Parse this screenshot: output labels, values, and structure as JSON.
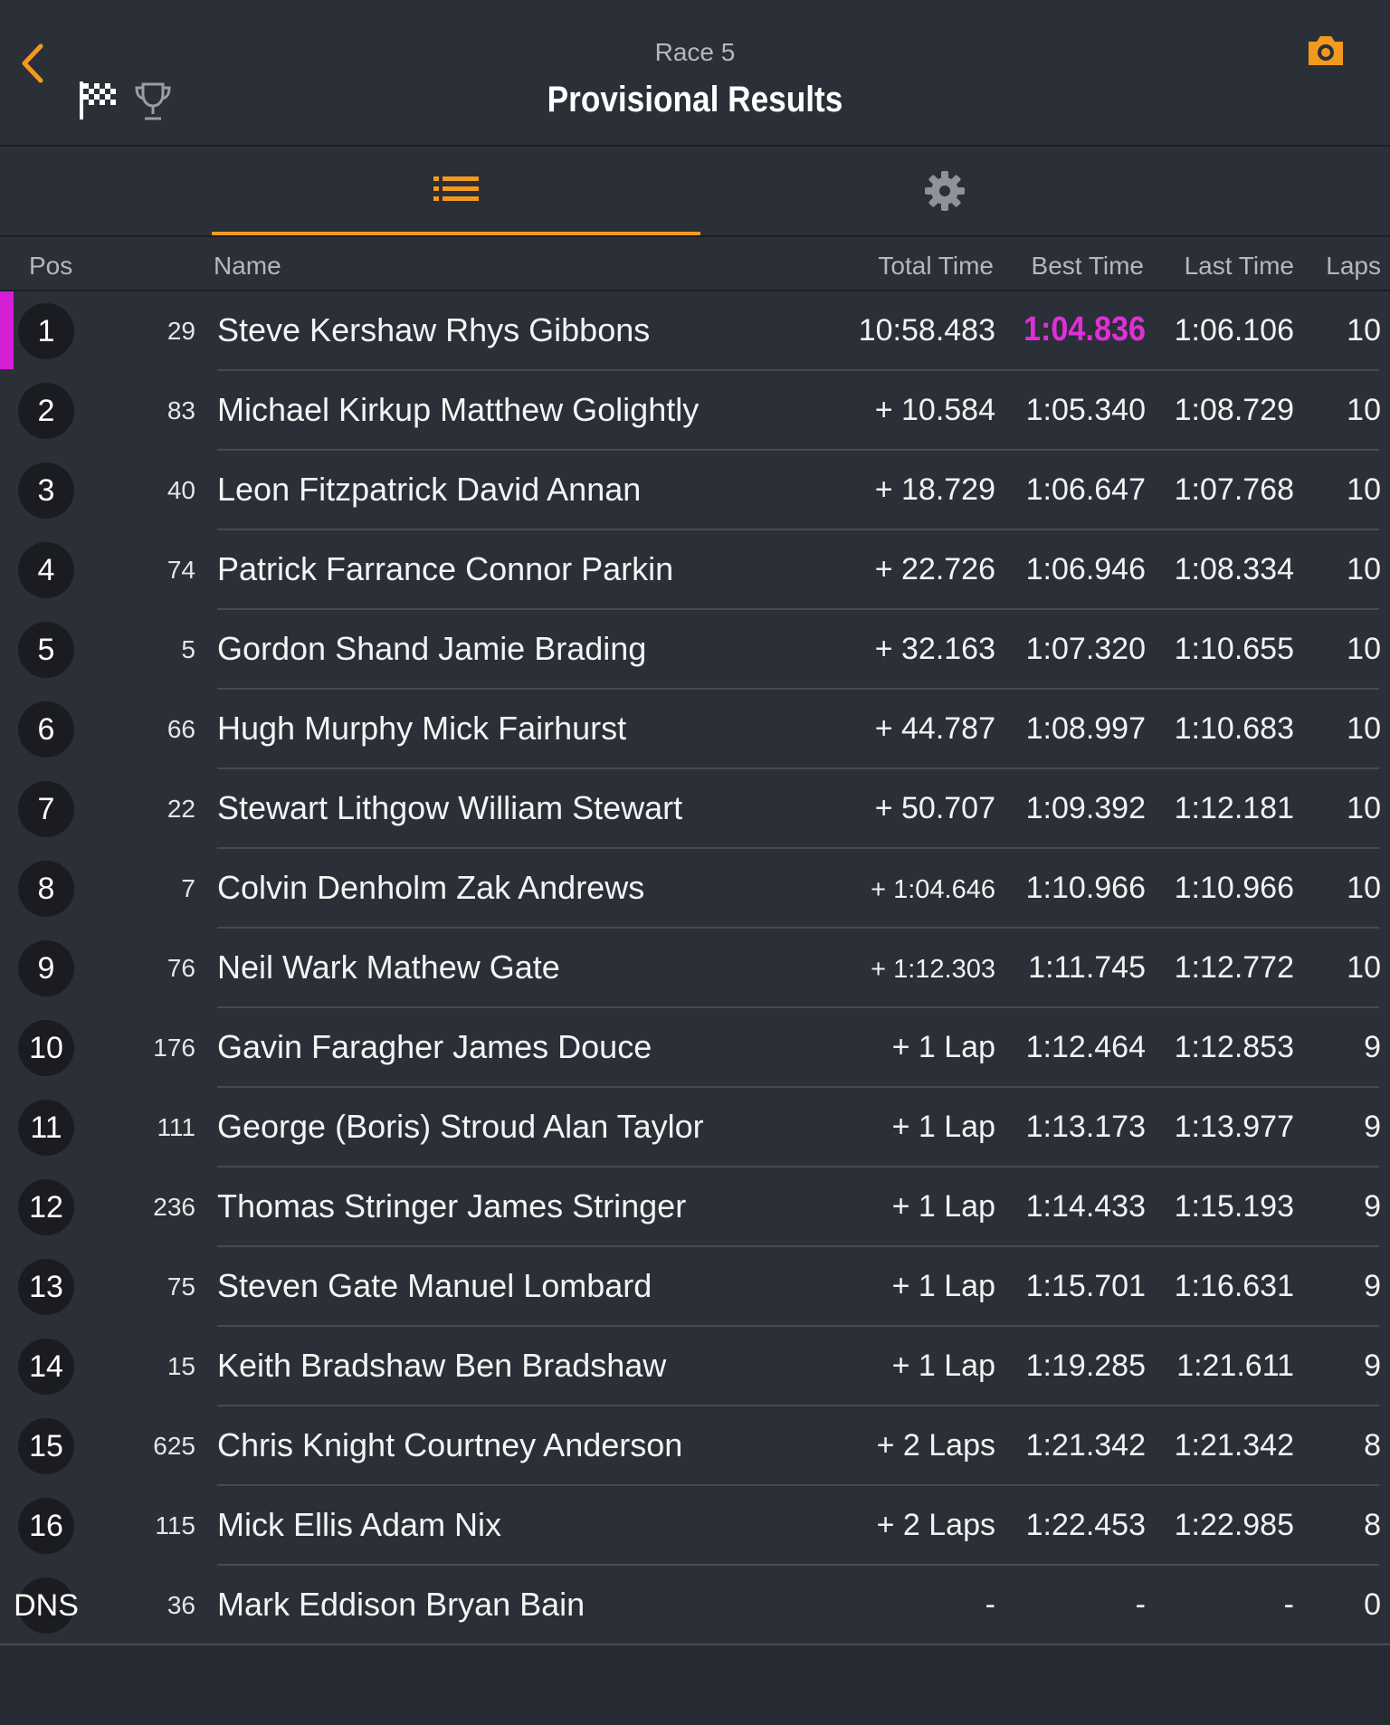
{
  "header": {
    "subtitle": "Race 5",
    "title": "Provisional Results",
    "accent_color": "#f39a1e",
    "icons": [
      "chevron-left-icon",
      "checkered-flag-icon",
      "trophy-icon",
      "camera-icon"
    ]
  },
  "tabs": [
    {
      "name": "list-icon",
      "active": true
    },
    {
      "name": "gear-icon",
      "active": false
    }
  ],
  "columns": {
    "pos": "Pos",
    "name": "Name",
    "total": "Total Time",
    "best": "Best Time",
    "last": "Last Time",
    "laps": "Laps"
  },
  "leader_color": "#d61ed6",
  "rows": [
    {
      "pos": "1",
      "num": "29",
      "name": "Steve Kershaw Rhys Gibbons",
      "total": "10:58.483",
      "best": "1:04.836",
      "last": "1:06.106",
      "laps": "10",
      "leader": true
    },
    {
      "pos": "2",
      "num": "83",
      "name": "Michael Kirkup Matthew Golightly",
      "total": "+ 10.584",
      "best": "1:05.340",
      "last": "1:08.729",
      "laps": "10"
    },
    {
      "pos": "3",
      "num": "40",
      "name": "Leon Fitzpatrick David Annan",
      "total": "+ 18.729",
      "best": "1:06.647",
      "last": "1:07.768",
      "laps": "10"
    },
    {
      "pos": "4",
      "num": "74",
      "name": "Patrick Farrance Connor Parkin",
      "total": "+ 22.726",
      "best": "1:06.946",
      "last": "1:08.334",
      "laps": "10"
    },
    {
      "pos": "5",
      "num": "5",
      "name": "Gordon Shand Jamie Brading",
      "total": "+ 32.163",
      "best": "1:07.320",
      "last": "1:10.655",
      "laps": "10"
    },
    {
      "pos": "6",
      "num": "66",
      "name": "Hugh Murphy Mick Fairhurst",
      "total": "+ 44.787",
      "best": "1:08.997",
      "last": "1:10.683",
      "laps": "10"
    },
    {
      "pos": "7",
      "num": "22",
      "name": "Stewart Lithgow William Stewart",
      "total": "+ 50.707",
      "best": "1:09.392",
      "last": "1:12.181",
      "laps": "10"
    },
    {
      "pos": "8",
      "num": "7",
      "name": "Colvin Denholm Zak Andrews",
      "total": "+ 1:04.646",
      "best": "1:10.966",
      "last": "1:10.966",
      "laps": "10"
    },
    {
      "pos": "9",
      "num": "76",
      "name": "Neil Wark Mathew Gate",
      "total": "+ 1:12.303",
      "best": "1:11.745",
      "last": "1:12.772",
      "laps": "10"
    },
    {
      "pos": "10",
      "num": "176",
      "name": "Gavin Faragher James Douce",
      "total": "+ 1 Lap",
      "best": "1:12.464",
      "last": "1:12.853",
      "laps": "9"
    },
    {
      "pos": "11",
      "num": "111",
      "name": "George (Boris) Stroud Alan Taylor",
      "total": "+ 1 Lap",
      "best": "1:13.173",
      "last": "1:13.977",
      "laps": "9"
    },
    {
      "pos": "12",
      "num": "236",
      "name": "Thomas Stringer James Stringer",
      "total": "+ 1 Lap",
      "best": "1:14.433",
      "last": "1:15.193",
      "laps": "9"
    },
    {
      "pos": "13",
      "num": "75",
      "name": "Steven Gate Manuel Lombard",
      "total": "+ 1 Lap",
      "best": "1:15.701",
      "last": "1:16.631",
      "laps": "9"
    },
    {
      "pos": "14",
      "num": "15",
      "name": "Keith Bradshaw Ben Bradshaw",
      "total": "+ 1 Lap",
      "best": "1:19.285",
      "last": "1:21.611",
      "laps": "9"
    },
    {
      "pos": "15",
      "num": "625",
      "name": "Chris Knight Courtney Anderson",
      "total": "+ 2 Laps",
      "best": "1:21.342",
      "last": "1:21.342",
      "laps": "8"
    },
    {
      "pos": "16",
      "num": "115",
      "name": "Mick Ellis Adam Nix",
      "total": "+ 2 Laps",
      "best": "1:22.453",
      "last": "1:22.985",
      "laps": "8"
    },
    {
      "pos": "DNS",
      "num": "36",
      "name": "Mark Eddison Bryan Bain",
      "total": "-",
      "best": "-",
      "last": "-",
      "laps": "0"
    }
  ]
}
